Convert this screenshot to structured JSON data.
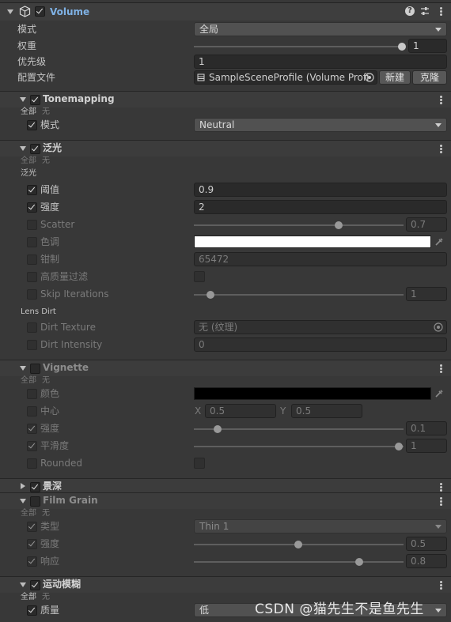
{
  "volume": {
    "title": "Volume",
    "mode_label": "模式",
    "mode_value": "全局",
    "weight_label": "权重",
    "weight_value": "1",
    "weight_fraction": 1.0,
    "priority_label": "优先级",
    "priority_value": "1",
    "profile_label": "配置文件",
    "profile_value": "SampleSceneProfile (Volume Profi",
    "new_label": "新建",
    "clone_label": "克隆"
  },
  "common": {
    "all": "全部",
    "none": "无"
  },
  "tonemapping": {
    "title": "Tonemapping",
    "mode_label": "模式",
    "mode_value": "Neutral"
  },
  "bloom": {
    "title": "泛光",
    "section_label": "泛光",
    "threshold_label": "阈值",
    "threshold_value": "0.9",
    "intensity_label": "强度",
    "intensity_value": "2",
    "scatter_label": "Scatter",
    "scatter_value": "0.7",
    "scatter_fraction": 0.7,
    "tint_label": "色调",
    "tint_color": "#ffffff",
    "clamp_label": "钳制",
    "clamp_value": "65472",
    "hq_label": "高质量过滤",
    "skip_label": "Skip Iterations",
    "skip_value": "1",
    "skip_fraction": 0.08,
    "lens_dirt_label": "Lens Dirt",
    "dirt_texture_label": "Dirt Texture",
    "dirt_texture_value": "无 (纹理)",
    "dirt_intensity_label": "Dirt Intensity",
    "dirt_intensity_value": "0"
  },
  "vignette": {
    "title": "Vignette",
    "color_label": "颜色",
    "color_value": "#000000",
    "center_label": "中心",
    "x_label": "X",
    "center_x": "0.5",
    "y_label": "Y",
    "center_y": "0.5",
    "intensity_label": "强度",
    "intensity_value": "0.1",
    "intensity_fraction": 0.1,
    "smooth_label": "平滑度",
    "smooth_value": "1",
    "smooth_fraction": 1.0,
    "rounded_label": "Rounded"
  },
  "dof": {
    "title": "景深"
  },
  "film_grain": {
    "title": "Film Grain",
    "type_label": "类型",
    "type_value": "Thin 1",
    "intensity_label": "强度",
    "intensity_value": "0.5",
    "intensity_fraction": 0.5,
    "response_label": "响应",
    "response_value": "0.8",
    "response_fraction": 0.8
  },
  "motion_blur": {
    "title": "运动模糊",
    "quality_label": "质量",
    "quality_value": "低"
  },
  "watermark": "CSDN @猫先生不是鱼先生"
}
